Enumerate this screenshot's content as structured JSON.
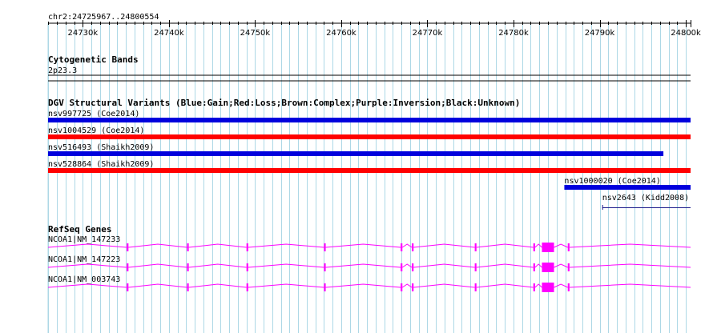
{
  "browser": {
    "region_label": "chr2:24725967..24800554",
    "region_start": 24725967,
    "region_end": 24800554,
    "ruler": {
      "major_ticks": [
        "24730k",
        "24740k",
        "24750k",
        "24760k",
        "24770k",
        "24780k",
        "24790k",
        "24800k"
      ],
      "major_values": [
        24730000,
        24740000,
        24750000,
        24760000,
        24770000,
        24780000,
        24790000,
        24800000
      ],
      "minor_step": 1000
    },
    "colors": {
      "grid": "#add8e6",
      "gain": "#0000dd",
      "loss": "#ff0000",
      "gene": "#ff00ff"
    },
    "cytoband_track": {
      "title": "Cytogenetic Bands",
      "band": "2p23.3"
    },
    "dgv_track": {
      "title": "DGV Structural Variants (Blue:Gain;Red:Loss;Brown:Complex;Purple:Inversion;Black:Unknown)",
      "features": [
        {
          "label": "nsv997725 (Coe2014)",
          "type": "gain",
          "start": 24725967,
          "end": 24800554
        },
        {
          "label": "nsv1004529 (Coe2014)",
          "type": "loss",
          "start": 24725967,
          "end": 24800554
        },
        {
          "label": "nsv516493 (Shaikh2009)",
          "type": "gain",
          "start": 24725967,
          "end": 24797400
        },
        {
          "label": "nsv528864 (Shaikh2009)",
          "type": "loss",
          "start": 24725967,
          "end": 24800554
        },
        {
          "label": "nsv1000020 (Coe2014)",
          "type": "gain",
          "start": 24785900,
          "end": 24800554
        },
        {
          "label": "nsv2643 (Kidd2008)",
          "type": "unknown",
          "start": 24790300,
          "end": 24800554
        }
      ]
    },
    "refseq_track": {
      "title": "RefSeq Genes",
      "transcripts": [
        {
          "label": "NCOA1|NM_147233"
        },
        {
          "label": "NCOA1|NM_147223"
        },
        {
          "label": "NCOA1|NM_003743"
        }
      ],
      "exons": [
        {
          "start": 24735100,
          "end": 24735300,
          "size": "small"
        },
        {
          "start": 24742100,
          "end": 24742300,
          "size": "small"
        },
        {
          "start": 24749000,
          "end": 24749200,
          "size": "small"
        },
        {
          "start": 24758000,
          "end": 24758200,
          "size": "small"
        },
        {
          "start": 24766900,
          "end": 24767100,
          "size": "small"
        },
        {
          "start": 24768200,
          "end": 24768400,
          "size": "small"
        },
        {
          "start": 24775500,
          "end": 24775700,
          "size": "small"
        },
        {
          "start": 24782300,
          "end": 24782500,
          "size": "small"
        },
        {
          "start": 24783300,
          "end": 24784700,
          "size": "large"
        },
        {
          "start": 24786300,
          "end": 24786500,
          "size": "small"
        }
      ]
    }
  }
}
